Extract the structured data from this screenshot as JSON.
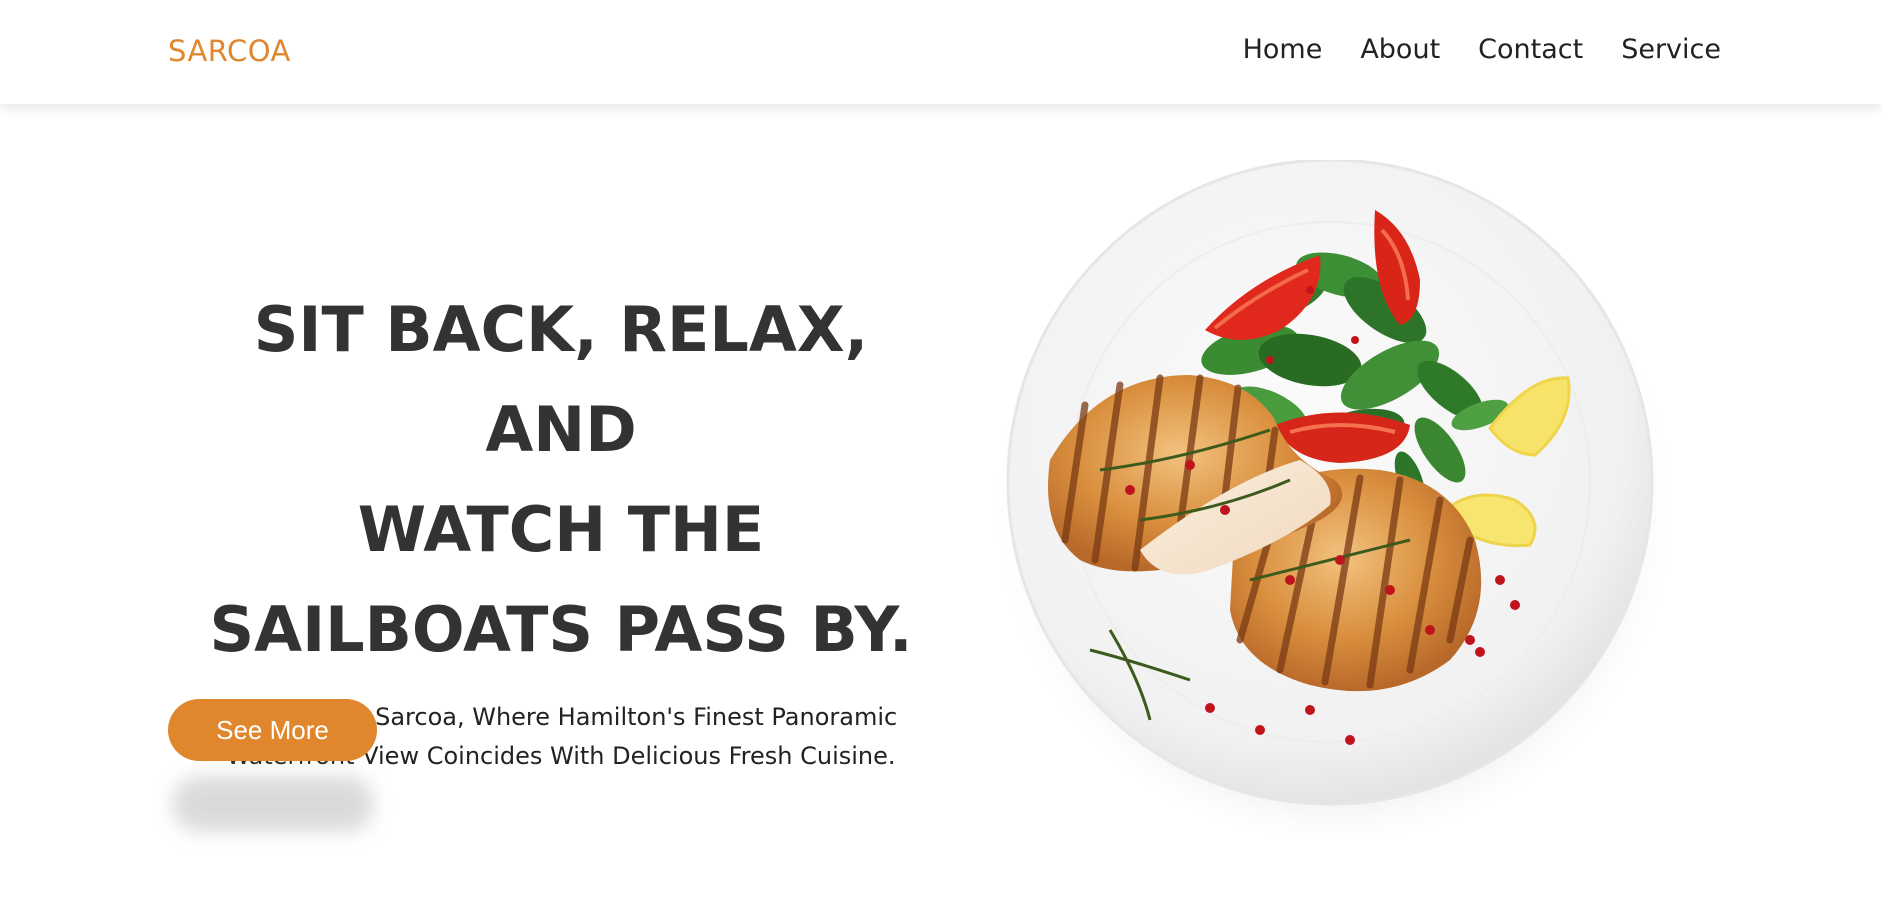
{
  "header": {
    "logo": "SARCOA",
    "nav": [
      {
        "label": "Home"
      },
      {
        "label": "About"
      },
      {
        "label": "Contact"
      },
      {
        "label": "Service"
      }
    ]
  },
  "hero": {
    "title_lines": [
      "SIT BACK, RELAX, AND",
      "WATCH THE",
      "SAILBOATS PASS BY."
    ],
    "subtitle_lines": [
      "Welcome To Sarcoa, Where Hamilton's Finest Panoramic",
      "Waterfront View Coincides With Delicious Fresh Cuisine."
    ],
    "cta_label": "See More"
  },
  "colors": {
    "accent": "#e0862d",
    "heading": "#333333",
    "nav_text": "#222222",
    "background": "#ffffff"
  },
  "image": {
    "icon": "grilled-chicken-salad-plate-image"
  }
}
